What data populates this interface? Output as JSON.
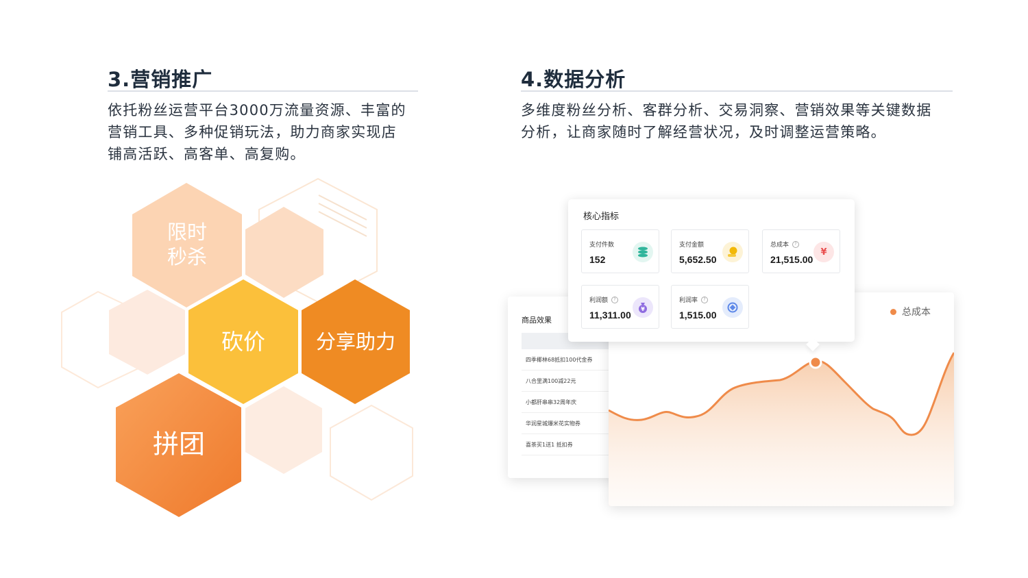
{
  "sections": [
    {
      "title": "3.营销推广",
      "desc_lines": [
        "依托粉丝运营平台3000万流量资源、丰富的",
        "营销工具、多种促销玩法，助力商家实现店",
        "铺高活跃、高客单、高复购。"
      ]
    },
    {
      "title": "4.数据分析",
      "desc_lines": [
        "多维度粉丝分析、客群分析、交易洞察、营销效果等关键数据",
        "分析，让商家随时了解经营状况，及时调整运营策略。"
      ]
    }
  ],
  "honeycomb": {
    "flash_sale": [
      "限时",
      "秒杀"
    ],
    "bargain": "砍价",
    "share_boost": "分享助力",
    "group_buy": "拼团"
  },
  "dashboard": {
    "metrics_title": "核心指标",
    "metrics": [
      {
        "label": "支付件数",
        "value": "152",
        "help": false,
        "icon": "coin-stack-icon",
        "icon_color": "#2fb59b",
        "icon_bg": "#e3f6f1"
      },
      {
        "label": "支付金额",
        "value": "5,652.50",
        "help": false,
        "icon": "coin-hand-icon",
        "icon_color": "#f2b807",
        "icon_bg": "#fdf3d6"
      },
      {
        "label": "总成本",
        "value": "21,515.00",
        "help": true,
        "icon": "yen-icon",
        "icon_color": "#e94e4e",
        "icon_bg": "#fde6e6"
      },
      {
        "label": "利润额",
        "value": "11,311.00",
        "help": true,
        "icon": "money-bag-icon",
        "icon_color": "#8f6ce0",
        "icon_bg": "#ece6fb"
      },
      {
        "label": "利润率",
        "value": "1,515.00",
        "help": true,
        "icon": "exchange-icon",
        "icon_color": "#5c87e8",
        "icon_bg": "#e4ecfc"
      }
    ],
    "help_glyph": "?",
    "product_title": "商品效果",
    "products": [
      "四季椰林68抵扣100代金券",
      "八合里满100减22元",
      "小都肝串串32周年庆",
      "华润星城爆米花实物券",
      "喜茶买1送1 抵扣券"
    ],
    "legend": "总成本",
    "accent_color": "#ef8b4a"
  }
}
